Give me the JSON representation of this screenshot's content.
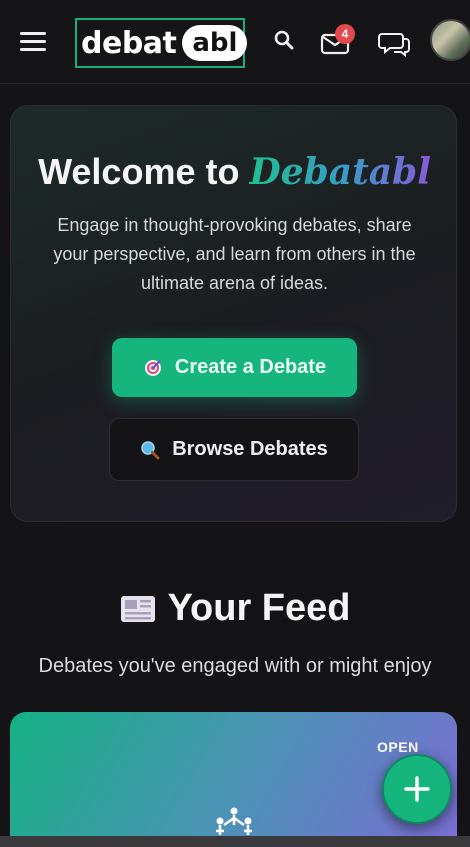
{
  "header": {
    "logo_left": "debat",
    "logo_right": "abl",
    "mail_badge": "4",
    "icons": [
      "menu-icon",
      "search-icon",
      "mail-icon",
      "chat-icon"
    ]
  },
  "welcome": {
    "title_prefix": "Welcome to ",
    "title_brand": "Debatabl",
    "description": "Engage in thought-provoking debates, share your perspective, and learn from others in the ultimate arena of ideas.",
    "create_button": "Create a Debate",
    "browse_button": "Browse Debates"
  },
  "feed": {
    "title": "Your Feed",
    "subtitle": "Debates you've engaged with or might enjoy",
    "cards": [
      {
        "status": "OPEN"
      }
    ]
  },
  "colors": {
    "accent": "#17b57e",
    "badge": "#e5484d",
    "background": "#141416"
  }
}
